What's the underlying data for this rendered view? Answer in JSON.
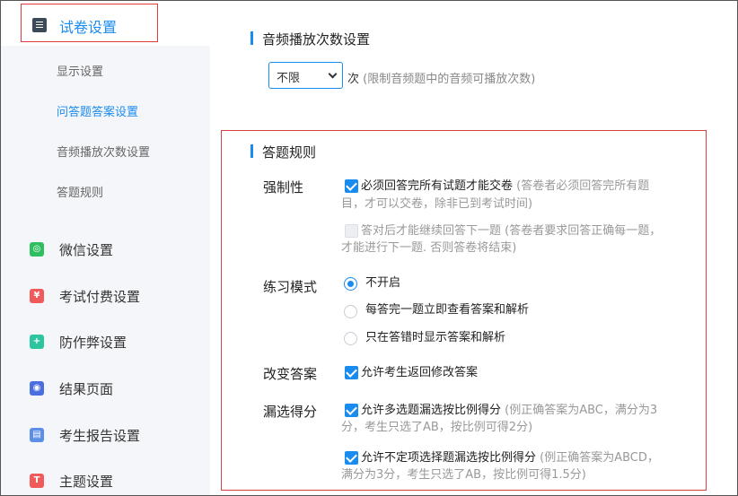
{
  "sidebar": {
    "header_label": "试卷设置",
    "sub_items": [
      "显示设置",
      "问答题答案设置",
      "音频播放次数设置",
      "答题规则"
    ],
    "main_items": [
      {
        "label": "微信设置",
        "icon": "wechat-icon",
        "color": "#2fbf60"
      },
      {
        "label": "考试付费设置",
        "icon": "yen-icon",
        "color": "#f05a5a"
      },
      {
        "label": "防作弊设置",
        "icon": "shield-icon",
        "color": "#2ec4a0"
      },
      {
        "label": "结果页面",
        "icon": "eye-icon",
        "color": "#4a6fe0"
      },
      {
        "label": "考生报告设置",
        "icon": "report-icon",
        "color": "#5b8ee6"
      },
      {
        "label": "主题设置",
        "icon": "shirt-icon",
        "color": "#f05a5a"
      }
    ]
  },
  "audio": {
    "title": "音频播放次数设置",
    "select_value": "不限",
    "unit": "次",
    "hint": "(限制音频题中的音频可播放次数)"
  },
  "rules": {
    "title": "答题规则",
    "mandatory": {
      "label": "强制性",
      "opt1_text": "必须回答完所有试题才能交卷",
      "opt1_hint_a": "(答卷者必须回答完所有题",
      "opt1_hint_b": "目，才可以交卷，除非已到考试时间)",
      "opt2_text": "答对后才能继续回答下一题",
      "opt2_hint_a": "(答卷者要求回答正确每一题，",
      "opt2_hint_b": "才能进行下一题. 否则答卷将结束)"
    },
    "practice": {
      "label": "练习模式",
      "options": [
        "不开启",
        "每答完一题立即查看答案和解析",
        "只在答错时显示答案和解析"
      ]
    },
    "change": {
      "label": "改变答案",
      "opt_text": "允许考生返回修改答案"
    },
    "partial": {
      "label": "漏选得分",
      "opt1_text": "允许多选题漏选按比例得分",
      "opt1_hint_a": "(例正确答案为ABC，满分为3",
      "opt1_hint_b": "分，考生只选了AB，按比例可得2分)",
      "opt2_text": "允许不定项选择题漏选按比例得分",
      "opt2_hint_a": "(例正确答案为ABCD，",
      "opt2_hint_b": "满分为3分，考生只选了AB，按比例可得1.5分)"
    }
  }
}
